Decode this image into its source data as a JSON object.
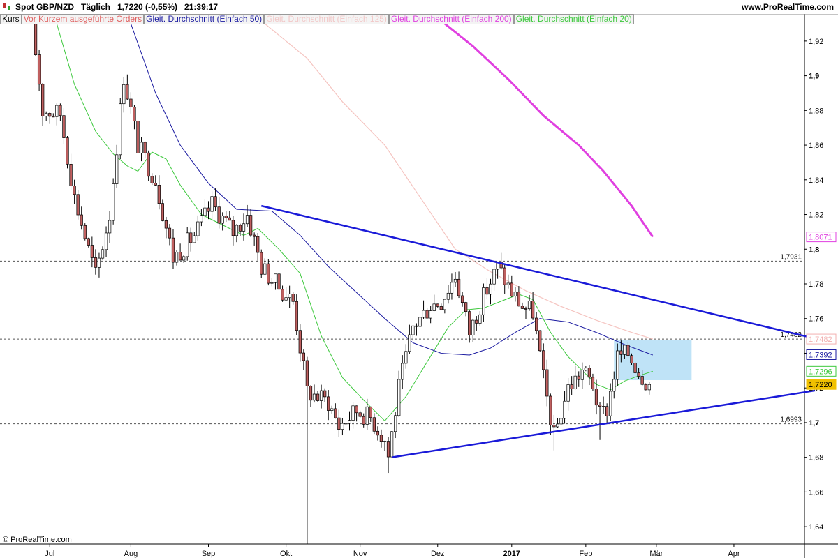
{
  "header": {
    "title": "Spot GBP/NZD   Täglich   1,7220 (-0,55%)   21:39:17",
    "site": "www.ProRealTime.com",
    "copyright": "© ProRealTime.com"
  },
  "legend": [
    {
      "label": "Kurs",
      "color": "#000000"
    },
    {
      "label": "Vor Kurzem ausgeführte Orders",
      "color": "#e06060"
    },
    {
      "label": "Gleit. Durchschnitt (Einfach 50)",
      "color": "#1a1aa0"
    },
    {
      "label": "Gleit. Durchschnitt (Einfach 125)",
      "color": "#f2c8c8"
    },
    {
      "label": "Gleit. Durchschnitt (Einfach 200)",
      "color": "#e040e0"
    },
    {
      "label": "Gleit. Durchschnitt (Einfach 20)",
      "color": "#3cc83c"
    }
  ],
  "chart_data": {
    "type": "candlestick",
    "instrument": "Spot GBP/NZD",
    "ylim": [
      1.63,
      1.93
    ],
    "y_ticks": [
      {
        "value": 1.92,
        "label": "1,92"
      },
      {
        "value": 1.9,
        "label": "1,9"
      },
      {
        "value": 1.88,
        "label": "1,88"
      },
      {
        "value": 1.86,
        "label": "1,86"
      },
      {
        "value": 1.84,
        "label": "1,84"
      },
      {
        "value": 1.82,
        "label": "1,82"
      },
      {
        "value": 1.8,
        "label": "1,8"
      },
      {
        "value": 1.78,
        "label": "1,78"
      },
      {
        "value": 1.76,
        "label": "1,76"
      },
      {
        "value": 1.74,
        "label": "1,74"
      },
      {
        "value": 1.72,
        "label": "1,72"
      },
      {
        "value": 1.7,
        "label": "1,7"
      },
      {
        "value": 1.68,
        "label": "1,68"
      },
      {
        "value": 1.66,
        "label": "1,66"
      },
      {
        "value": 1.64,
        "label": "1,64"
      }
    ],
    "x_ticks": [
      {
        "label": "Jul",
        "bar": 5
      },
      {
        "label": "Aug",
        "bar": 28
      },
      {
        "label": "Sep",
        "bar": 50
      },
      {
        "label": "Okt",
        "bar": 72
      },
      {
        "label": "Nov",
        "bar": 93
      },
      {
        "label": "Dez",
        "bar": 115
      },
      {
        "label": "2017",
        "bar": 136,
        "bold": true
      },
      {
        "label": "Feb",
        "bar": 157
      },
      {
        "label": "Mär",
        "bar": 177
      },
      {
        "label": "Apr",
        "bar": 199
      }
    ],
    "bar_count": 176,
    "x_max_bar": 222,
    "anchors": [
      {
        "bar": 0,
        "value": 1.93
      },
      {
        "bar": 3,
        "value": 1.88
      },
      {
        "bar": 8,
        "value": 1.878
      },
      {
        "bar": 12,
        "value": 1.83
      },
      {
        "bar": 18,
        "value": 1.785
      },
      {
        "bar": 22,
        "value": 1.82
      },
      {
        "bar": 26,
        "value": 1.9
      },
      {
        "bar": 30,
        "value": 1.86
      },
      {
        "bar": 35,
        "value": 1.84
      },
      {
        "bar": 40,
        "value": 1.795
      },
      {
        "bar": 46,
        "value": 1.808
      },
      {
        "bar": 51,
        "value": 1.826
      },
      {
        "bar": 57,
        "value": 1.81
      },
      {
        "bar": 61,
        "value": 1.82
      },
      {
        "bar": 65,
        "value": 1.79
      },
      {
        "bar": 69,
        "value": 1.78
      },
      {
        "bar": 74,
        "value": 1.77
      },
      {
        "bar": 78,
        "value": 1.718
      },
      {
        "bar": 84,
        "value": 1.712
      },
      {
        "bar": 87,
        "value": 1.698
      },
      {
        "bar": 92,
        "value": 1.707
      },
      {
        "bar": 96,
        "value": 1.703
      },
      {
        "bar": 100,
        "value": 1.69
      },
      {
        "bar": 101,
        "value": 1.681
      },
      {
        "bar": 104,
        "value": 1.72
      },
      {
        "bar": 108,
        "value": 1.755
      },
      {
        "bar": 113,
        "value": 1.768
      },
      {
        "bar": 116,
        "value": 1.77
      },
      {
        "bar": 120,
        "value": 1.785
      },
      {
        "bar": 124,
        "value": 1.752
      },
      {
        "bar": 127,
        "value": 1.768
      },
      {
        "bar": 132,
        "value": 1.79
      },
      {
        "bar": 136,
        "value": 1.775
      },
      {
        "bar": 139,
        "value": 1.767
      },
      {
        "bar": 142,
        "value": 1.764
      },
      {
        "bar": 145,
        "value": 1.725
      },
      {
        "bar": 148,
        "value": 1.692
      },
      {
        "bar": 152,
        "value": 1.72
      },
      {
        "bar": 156,
        "value": 1.73
      },
      {
        "bar": 159,
        "value": 1.722
      },
      {
        "bar": 161,
        "value": 1.704
      },
      {
        "bar": 163,
        "value": 1.708
      },
      {
        "bar": 166,
        "value": 1.738
      },
      {
        "bar": 169,
        "value": 1.74
      },
      {
        "bar": 172,
        "value": 1.73
      },
      {
        "bar": 175,
        "value": 1.722
      }
    ],
    "last_price": 1.722,
    "horizontal_levels": [
      {
        "value": 1.7931,
        "label": "1,7931"
      },
      {
        "value": 1.7482,
        "label": "1,7482"
      },
      {
        "value": 1.6993,
        "label": "1,6993"
      }
    ],
    "trendlines": [
      {
        "name": "upper",
        "from": {
          "bar": 65,
          "value": 1.825
        },
        "to": {
          "bar": 222,
          "value": 1.7485
        }
      },
      {
        "name": "lower",
        "from": {
          "bar": 102,
          "value": 1.68
        },
        "to": {
          "bar": 222,
          "value": 1.7185
        }
      }
    ],
    "highlight_box": {
      "from_bar": 165,
      "to_bar": 187,
      "high": 1.7475,
      "low": 1.7245
    },
    "price_tags": [
      {
        "value": 1.8071,
        "label": "1,8071",
        "color": "#e040e0"
      },
      {
        "value": 1.7482,
        "label": "1,7482",
        "color": "#f2b0b0"
      },
      {
        "value": 1.7392,
        "label": "1,7392",
        "color": "#1a1aa0"
      },
      {
        "value": 1.7296,
        "label": "1,7296",
        "color": "#3cc83c"
      },
      {
        "value": 1.722,
        "label": "1,7220",
        "color": "#f0c000",
        "filled": true
      }
    ],
    "moving_averages": [
      {
        "name": "Gleit. Durchschnitt (Einfach 50)",
        "color": "#1a1aa0",
        "period": 50
      },
      {
        "name": "Gleit. Durchschnitt (Einfach 125)",
        "color": "#f2c8c8",
        "period": 125
      },
      {
        "name": "Gleit. Durchschnitt (Einfach 200)",
        "color": "#e040e0",
        "period": 200
      },
      {
        "name": "Gleit. Durchschnitt (Einfach 20)",
        "color": "#3cc83c",
        "period": 20
      }
    ],
    "ma50_points": [
      {
        "bar": 28,
        "value": 1.93
      },
      {
        "bar": 35,
        "value": 1.89
      },
      {
        "bar": 42,
        "value": 1.86
      },
      {
        "bar": 50,
        "value": 1.838
      },
      {
        "bar": 58,
        "value": 1.823
      },
      {
        "bar": 68,
        "value": 1.822
      },
      {
        "bar": 76,
        "value": 1.808
      },
      {
        "bar": 84,
        "value": 1.79
      },
      {
        "bar": 92,
        "value": 1.775
      },
      {
        "bar": 100,
        "value": 1.76
      },
      {
        "bar": 108,
        "value": 1.746
      },
      {
        "bar": 116,
        "value": 1.74
      },
      {
        "bar": 124,
        "value": 1.739
      },
      {
        "bar": 130,
        "value": 1.743
      },
      {
        "bar": 137,
        "value": 1.752
      },
      {
        "bar": 144,
        "value": 1.76
      },
      {
        "bar": 152,
        "value": 1.758
      },
      {
        "bar": 160,
        "value": 1.752
      },
      {
        "bar": 168,
        "value": 1.745
      },
      {
        "bar": 176,
        "value": 1.739
      }
    ],
    "ma125_points": [
      {
        "bar": 66,
        "value": 1.93
      },
      {
        "bar": 78,
        "value": 1.91
      },
      {
        "bar": 88,
        "value": 1.885
      },
      {
        "bar": 100,
        "value": 1.86
      },
      {
        "bar": 110,
        "value": 1.83
      },
      {
        "bar": 120,
        "value": 1.8
      },
      {
        "bar": 130,
        "value": 1.787
      },
      {
        "bar": 140,
        "value": 1.776
      },
      {
        "bar": 150,
        "value": 1.767
      },
      {
        "bar": 160,
        "value": 1.759
      },
      {
        "bar": 170,
        "value": 1.752
      },
      {
        "bar": 176,
        "value": 1.7482
      }
    ],
    "ma200_points": [
      {
        "bar": 117,
        "value": 1.93
      },
      {
        "bar": 125,
        "value": 1.917
      },
      {
        "bar": 135,
        "value": 1.898
      },
      {
        "bar": 145,
        "value": 1.877
      },
      {
        "bar": 155,
        "value": 1.86
      },
      {
        "bar": 162,
        "value": 1.845
      },
      {
        "bar": 170,
        "value": 1.825
      },
      {
        "bar": 176,
        "value": 1.8071
      }
    ],
    "ma20_points": [
      {
        "bar": 7,
        "value": 1.93
      },
      {
        "bar": 12,
        "value": 1.895
      },
      {
        "bar": 18,
        "value": 1.868
      },
      {
        "bar": 23,
        "value": 1.855
      },
      {
        "bar": 27,
        "value": 1.848
      },
      {
        "bar": 30,
        "value": 1.845
      },
      {
        "bar": 34,
        "value": 1.856
      },
      {
        "bar": 38,
        "value": 1.852
      },
      {
        "bar": 42,
        "value": 1.837
      },
      {
        "bar": 48,
        "value": 1.82
      },
      {
        "bar": 54,
        "value": 1.814
      },
      {
        "bar": 60,
        "value": 1.808
      },
      {
        "bar": 64,
        "value": 1.812
      },
      {
        "bar": 70,
        "value": 1.8
      },
      {
        "bar": 76,
        "value": 1.786
      },
      {
        "bar": 82,
        "value": 1.75
      },
      {
        "bar": 88,
        "value": 1.726
      },
      {
        "bar": 94,
        "value": 1.713
      },
      {
        "bar": 100,
        "value": 1.701
      },
      {
        "bar": 106,
        "value": 1.715
      },
      {
        "bar": 112,
        "value": 1.735
      },
      {
        "bar": 118,
        "value": 1.755
      },
      {
        "bar": 123,
        "value": 1.765
      },
      {
        "bar": 128,
        "value": 1.766
      },
      {
        "bar": 133,
        "value": 1.77
      },
      {
        "bar": 138,
        "value": 1.774
      },
      {
        "bar": 142,
        "value": 1.771
      },
      {
        "bar": 147,
        "value": 1.752
      },
      {
        "bar": 152,
        "value": 1.738
      },
      {
        "bar": 156,
        "value": 1.73
      },
      {
        "bar": 160,
        "value": 1.722
      },
      {
        "bar": 164,
        "value": 1.719
      },
      {
        "bar": 168,
        "value": 1.724
      },
      {
        "bar": 172,
        "value": 1.727
      },
      {
        "bar": 176,
        "value": 1.7296
      }
    ],
    "spikes": [
      {
        "bar": 78,
        "low": 1.63
      },
      {
        "bar": 101,
        "low": 1.671
      },
      {
        "bar": 148,
        "low": 1.684
      },
      {
        "bar": 161,
        "low": 1.69
      }
    ],
    "colors": {
      "up": "#ffffff",
      "down": "#c06060",
      "wick": "#000000",
      "grid": "#555555",
      "trend": "#1a1ad8",
      "box": "#bfe3f7"
    }
  }
}
